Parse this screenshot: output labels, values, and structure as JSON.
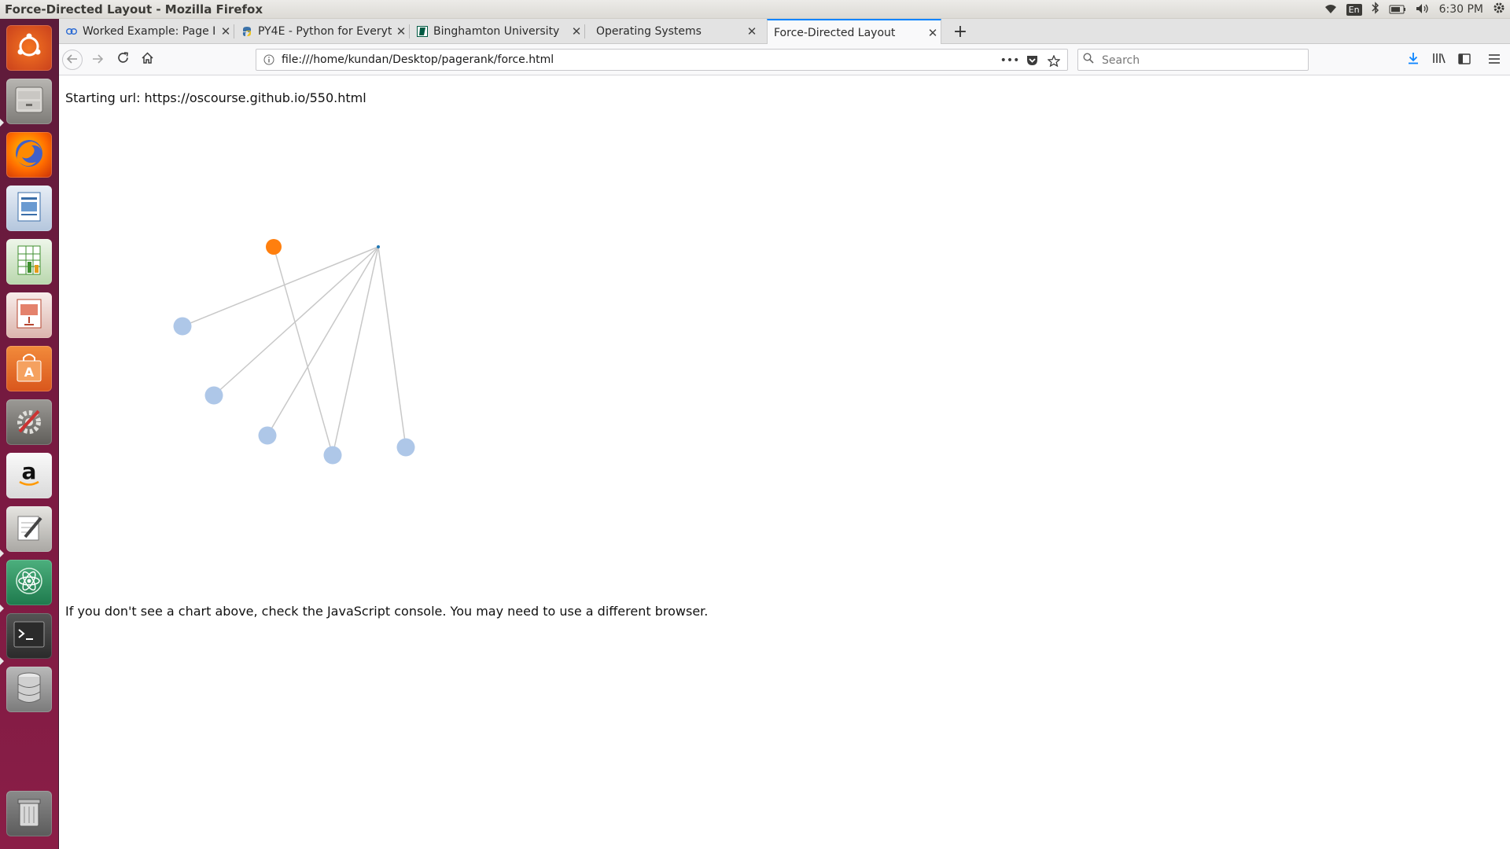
{
  "window": {
    "title": "Force-Directed Layout - Mozilla Firefox"
  },
  "tray": {
    "keyboard_layout": "En",
    "clock": "6:30 PM",
    "icons": [
      "wifi-icon",
      "bluetooth-icon",
      "battery-icon",
      "volume-icon",
      "gear-icon"
    ]
  },
  "launcher": {
    "items": [
      {
        "name": "ubuntu-dash",
        "icon": "ubuntu-logo-icon"
      },
      {
        "name": "files",
        "icon": "file-cabinet-icon"
      },
      {
        "name": "firefox",
        "icon": "firefox-icon"
      },
      {
        "name": "libreoffice-writer",
        "icon": "document-icon"
      },
      {
        "name": "libreoffice-calc",
        "icon": "spreadsheet-icon"
      },
      {
        "name": "libreoffice-impress",
        "icon": "presentation-icon"
      },
      {
        "name": "ubuntu-software",
        "icon": "shopping-bag-icon"
      },
      {
        "name": "system-settings",
        "icon": "wrench-gear-icon"
      },
      {
        "name": "amazon",
        "icon": "amazon-icon"
      },
      {
        "name": "text-editor",
        "icon": "pencil-paper-icon"
      },
      {
        "name": "atom",
        "icon": "atom-icon"
      },
      {
        "name": "terminal",
        "icon": "terminal-icon"
      },
      {
        "name": "database",
        "icon": "database-icon"
      },
      {
        "name": "trash",
        "icon": "trash-icon"
      }
    ]
  },
  "tabs": [
    {
      "label": "Worked Example: Page I",
      "favicon": "link-icon",
      "active": false
    },
    {
      "label": "PY4E - Python for Everyt",
      "favicon": "python-icon",
      "active": false
    },
    {
      "label": "Binghamton University",
      "favicon": "binghamton-icon",
      "active": false
    },
    {
      "label": "Operating Systems",
      "favicon": "",
      "active": false
    },
    {
      "label": "Force-Directed Layout",
      "favicon": "",
      "active": true
    }
  ],
  "nav": {
    "url": "file:///home/kundan/Desktop/pagerank/force.html",
    "search_placeholder": "Search"
  },
  "page": {
    "starting_url_text": "Starting url: https://oscourse.github.io/550.html",
    "note_text": "If you don't see a chart above, check the JavaScript console. You may need to use a different browser."
  },
  "chart_data": {
    "type": "network",
    "colors": {
      "highlight_node": "#ff7f0e",
      "default_node": "#aec7e8",
      "edge": "#c8c8c8"
    },
    "nodes": [
      {
        "id": "hub",
        "size": "small",
        "group": "default"
      },
      {
        "id": "orange",
        "size": "medium",
        "group": "highlight"
      },
      {
        "id": "n1",
        "size": "large",
        "group": "default"
      },
      {
        "id": "n2",
        "size": "large",
        "group": "default"
      },
      {
        "id": "n3",
        "size": "large",
        "group": "default"
      },
      {
        "id": "n4",
        "size": "large",
        "group": "default"
      },
      {
        "id": "n5",
        "size": "large",
        "group": "default"
      }
    ],
    "edges": [
      {
        "source": "hub",
        "target": "n1"
      },
      {
        "source": "hub",
        "target": "n2"
      },
      {
        "source": "hub",
        "target": "n3"
      },
      {
        "source": "hub",
        "target": "n4"
      },
      {
        "source": "hub",
        "target": "n5"
      },
      {
        "source": "orange",
        "target": "n4"
      }
    ]
  }
}
